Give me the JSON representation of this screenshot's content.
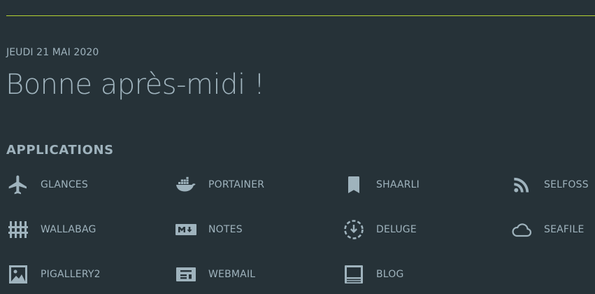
{
  "header": {
    "date": "JEUDI 21 MAI 2020",
    "greeting": "Bonne après-midi !"
  },
  "applications": {
    "title": "APPLICATIONS",
    "items": [
      {
        "label": "GLANCES",
        "icon": "airplane-icon"
      },
      {
        "label": "PORTAINER",
        "icon": "docker-icon"
      },
      {
        "label": "SHAARLI",
        "icon": "bookmark-icon"
      },
      {
        "label": "SELFOSS",
        "icon": "rss-icon"
      },
      {
        "label": "WALLABAG",
        "icon": "wallabag-icon"
      },
      {
        "label": "NOTES",
        "icon": "markdown-icon"
      },
      {
        "label": "DELUGE",
        "icon": "download-circle-icon"
      },
      {
        "label": "SEAFILE",
        "icon": "cloud-icon"
      },
      {
        "label": "PIGALLERY2",
        "icon": "image-icon"
      },
      {
        "label": "WEBMAIL",
        "icon": "mail-card-icon"
      },
      {
        "label": "BLOG",
        "icon": "blog-icon"
      }
    ]
  },
  "colors": {
    "background": "#263238",
    "text": "#9fb3bd",
    "accent_rule": "#b4d232"
  }
}
